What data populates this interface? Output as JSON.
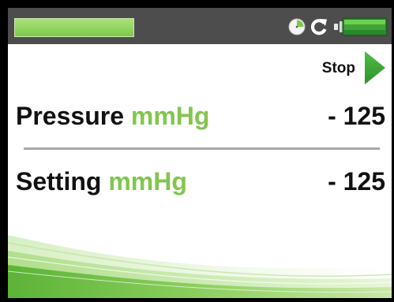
{
  "status_bar": {
    "progress": 1.0,
    "icons": [
      "clock-icon",
      "refresh-icon",
      "battery-icon"
    ]
  },
  "controls": {
    "stop_label": "Stop",
    "play_icon": "play-icon"
  },
  "readings": {
    "pressure": {
      "label": "Pressure",
      "unit": "mmHg",
      "value": "- 125"
    },
    "setting": {
      "label": "Setting",
      "unit": "mmHg",
      "value": "- 125"
    }
  },
  "colors": {
    "accent_green": "#82c64d",
    "status_bar_bg": "#4d4d4d",
    "play_green": "#3ea63a",
    "divider": "#a8a8a8"
  }
}
